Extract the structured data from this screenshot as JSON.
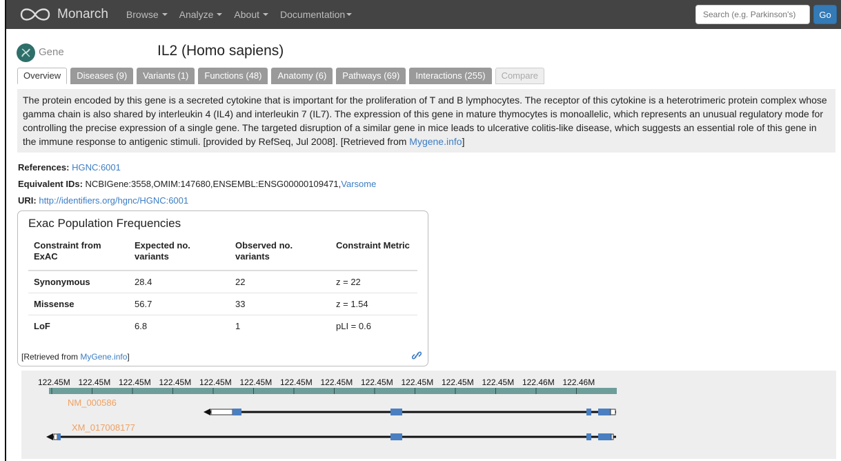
{
  "navbar": {
    "brand": "Monarch",
    "items": [
      "Browse",
      "Analyze",
      "About",
      "Documentation"
    ],
    "search_placeholder": "Search (e.g. Parkinson's)",
    "go_label": "Go"
  },
  "header": {
    "category": "Gene",
    "title": "IL2  (Homo sapiens)"
  },
  "tabs": [
    {
      "label": "Overview",
      "state": "active"
    },
    {
      "label": "Diseases (9)",
      "state": "normal"
    },
    {
      "label": "Variants (1)",
      "state": "normal"
    },
    {
      "label": "Functions (48)",
      "state": "normal"
    },
    {
      "label": "Anatomy (6)",
      "state": "normal"
    },
    {
      "label": "Pathways (69)",
      "state": "normal"
    },
    {
      "label": "Interactions (255)",
      "state": "normal"
    },
    {
      "label": "Compare",
      "state": "disabled"
    }
  ],
  "description": {
    "text": "The protein encoded by this gene is a secreted cytokine that is important for the proliferation of T and B lymphocytes. The receptor of this cytokine is a heterotrimeric protein complex whose gamma chain is also shared by interleukin 4 (IL4) and interleukin 7 (IL7). The expression of this gene in mature thymocytes is monoallelic, which represents an unusual regulatory mode for controlling the precise expression of a single gene. The targeted disruption of a similar gene in mice leads to ulcerative colitis-like disease, which suggests an essential role of this gene in the immune response to antigenic stimuli. [provided by RefSeq, Jul 2008]. [Retrieved from ",
    "link": "Mygene.info",
    "suffix": "]"
  },
  "references": {
    "label": "References:",
    "value": "HGNC:6001"
  },
  "equivalent_ids": {
    "label": "Equivalent IDs:",
    "value": "NCBIGene:3558,OMIM:147680,ENSEMBL:ENSG00000109471,",
    "link": "Varsome"
  },
  "uri": {
    "label": "URI:",
    "value": "http://identifiers.org/hgnc/HGNC:6001"
  },
  "exac": {
    "title": "Exac Population Frequencies",
    "headers": [
      "Constraint from ExAC",
      "Expected no. variants",
      "Observed no. variants",
      "Constraint Metric"
    ],
    "rows": [
      [
        "Synonymous",
        "28.4",
        "22",
        "z = 22"
      ],
      [
        "Missense",
        "56.7",
        "33",
        "z = 1.54"
      ],
      [
        "LoF",
        "6.8",
        "1",
        "pLI = 0.6"
      ]
    ],
    "retrieved_prefix": "[Retrieved from ",
    "retrieved_link": "MyGene.info",
    "retrieved_suffix": "]"
  },
  "genome_track": {
    "ticks": [
      "122.45M",
      "122.45M",
      "122.45M",
      "122.45M",
      "122.45M",
      "122.45M",
      "122.45M",
      "122.45M",
      "122.45M",
      "122.45M",
      "122.45M",
      "122.45M",
      "122.46M",
      "122.46M"
    ],
    "transcripts": [
      "NM_000586",
      "XM_017008177"
    ],
    "colors": {
      "axis": "#6e9e99",
      "exon": "#4a7fc1",
      "label": "#f0a060"
    }
  }
}
